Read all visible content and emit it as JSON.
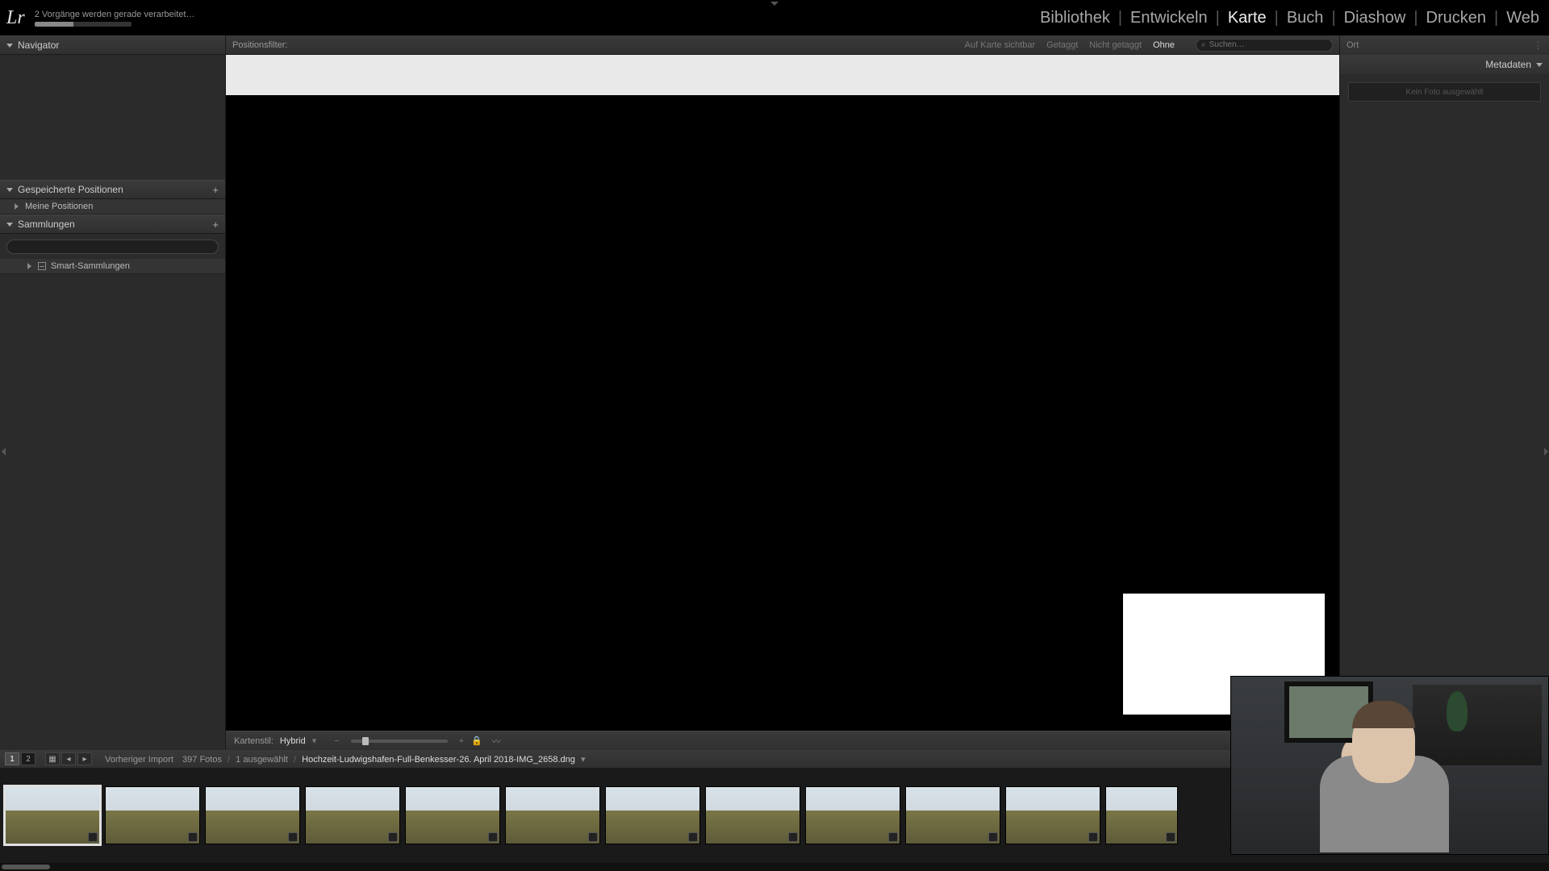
{
  "app": {
    "logo": "Lr"
  },
  "status": {
    "text": "2 Vorgänge werden gerade verarbeitet…"
  },
  "modules": {
    "items": [
      "Bibliothek",
      "Entwickeln",
      "Karte",
      "Buch",
      "Diashow",
      "Drucken",
      "Web"
    ],
    "active_index": 2
  },
  "left_panel": {
    "navigator": "Navigator",
    "saved_locations": {
      "title": "Gespeicherte Positionen",
      "item": "Meine Positionen"
    },
    "collections": {
      "title": "Sammlungen",
      "smart": "Smart-Sammlungen",
      "search_placeholder": ""
    }
  },
  "center": {
    "filter_label": "Positionsfilter:",
    "filters": {
      "visible": "Auf Karte sichtbar",
      "tagged": "Getaggt",
      "untagged": "Nicht getaggt",
      "none": "Ohne"
    },
    "search_placeholder": "Suchen…",
    "map_style_label": "Kartenstil:",
    "map_style_value": "Hybrid"
  },
  "right_panel": {
    "ort_label": "Ort",
    "metadata": "Metadaten",
    "placeholder": "Kein Foto ausgewählt"
  },
  "filmstrip": {
    "crumb_source": "Vorheriger Import",
    "crumb_count": "397 Fotos",
    "crumb_selected": "1 ausgewählt",
    "crumb_file": "Hochzeit-Ludwigshafen-Full-Benkesser-26. April 2018-IMG_2658.dng",
    "thumb_count": 12
  }
}
